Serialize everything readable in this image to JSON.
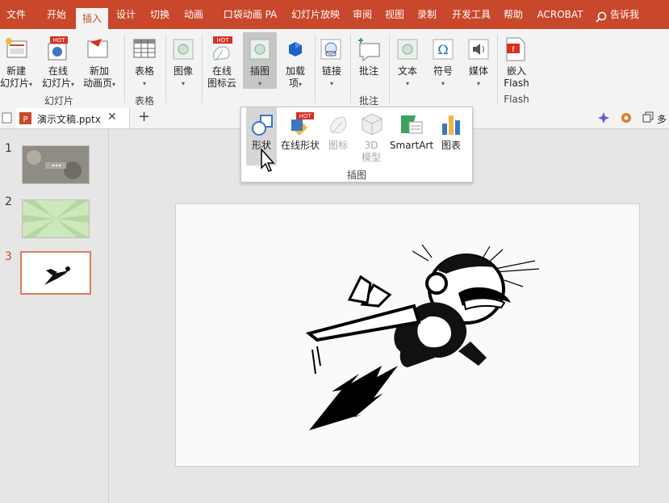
{
  "menubar": {
    "tabs": [
      "文件",
      "开始",
      "插入",
      "设计",
      "切换",
      "动画",
      "口袋动画 PA",
      "幻灯片放映",
      "审阅",
      "视图",
      "录制",
      "开发工具",
      "帮助",
      "ACROBAT"
    ],
    "active_tab": "插入",
    "tell_me": "告诉我"
  },
  "ribbon": {
    "new_slide": [
      "新建",
      "幻灯片"
    ],
    "online_slide": [
      "在线",
      "幻灯片"
    ],
    "new_anim_page": [
      "新加",
      "动画页"
    ],
    "group_slides": "幻灯片",
    "table": "表格",
    "group_table": "表格",
    "image": "图像",
    "online_icon_cloud": [
      "在线",
      "图标云"
    ],
    "illustrations": "插图",
    "addins": [
      "加载",
      "项"
    ],
    "links": "链接",
    "comment": "批注",
    "group_comment": "批注",
    "text": "文本",
    "symbol": "符号",
    "media": "媒体",
    "embed_flash": [
      "嵌入",
      "Flash"
    ],
    "group_flash": "Flash",
    "hot_badge": "HOT"
  },
  "doc_tab": {
    "filename": "演示文稿.pptx",
    "right_more": "多"
  },
  "dropdown": {
    "items": [
      {
        "label": "形状",
        "enabled": true
      },
      {
        "label": "在线形状",
        "enabled": true
      },
      {
        "label": "图标",
        "enabled": false
      },
      {
        "label": "3D",
        "label2": "模型",
        "enabled": false
      },
      {
        "label": "SmartArt",
        "enabled": true
      },
      {
        "label": "图表",
        "enabled": true
      }
    ],
    "group_label": "插图"
  },
  "slides": {
    "numbers": [
      "1",
      "2",
      "3"
    ],
    "active": "3"
  },
  "colors": {
    "accent": "#c9472b",
    "ribbon_bg": "#f3f3f3",
    "workspace": "#e6e6e6"
  }
}
